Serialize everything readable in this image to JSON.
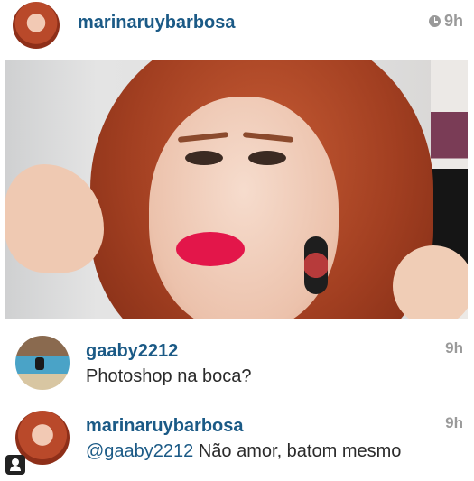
{
  "post": {
    "username": "marinaruybarbosa",
    "time": "9h",
    "time_icon": "clock-icon"
  },
  "comments": [
    {
      "username": "gaaby2212",
      "time": "9h",
      "mention": "",
      "text": "Photoshop na boca?"
    },
    {
      "username": "marinaruybarbosa",
      "time": "9h",
      "mention": "@gaaby2212",
      "text": " Não amor, batom mesmo"
    }
  ],
  "colors": {
    "username": "#1b5a86",
    "timestamp": "#9a9a9a",
    "lipstick": "#e3164a"
  }
}
